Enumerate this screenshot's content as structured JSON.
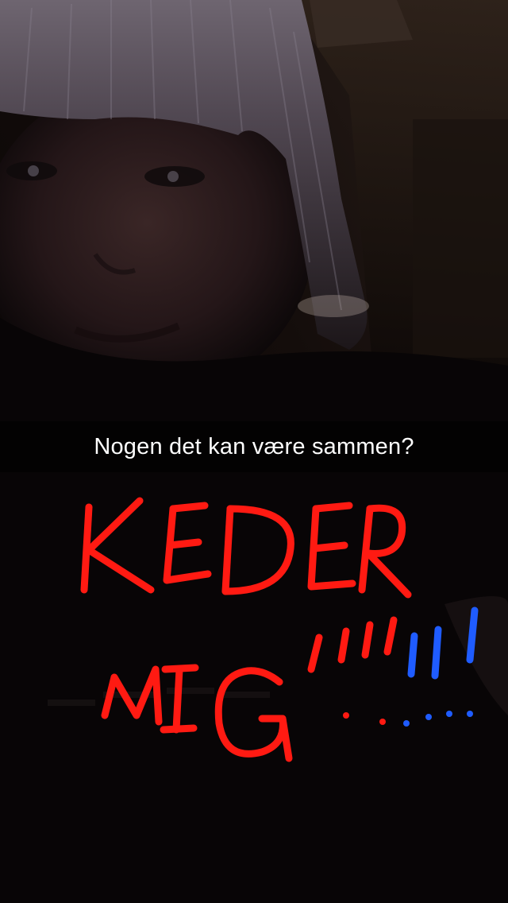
{
  "snap": {
    "caption": "Nogen det kan være sammen?",
    "drawing": {
      "line1": "KEDER",
      "line2": "MIG",
      "exclamations": "!!!!!!",
      "colors": {
        "primary": "#ff1a12",
        "secondary": "#1f5cff"
      }
    }
  }
}
